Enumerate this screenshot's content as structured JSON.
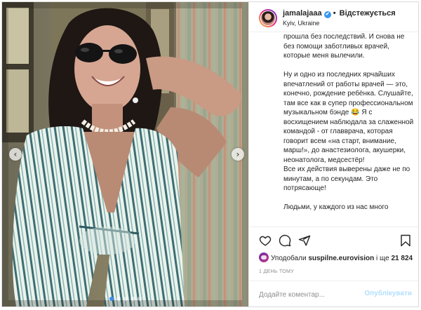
{
  "header": {
    "username": "jamalajaaa",
    "verified_badge": "✔",
    "separator": "•",
    "follow_label": "Відстежується",
    "location": "Kyiv, Ukraine"
  },
  "caption": {
    "text": "Так как слабенькое место у меня самое ценное — горло. Благо, болезнь прошла без последствий. И снова не без помощи заботливых врачей, которые меня вылечили.\n\nНу и одно из последних ярчайших впечатлений от работы врачей — это, конечно, рождение ребёнка. Слушайте, там все как в супер профессиональном музыкальном бэнде 😂 Я с восхищением наблюдала за слаженной командой - от главврача, которая говорит всем «на старт, внимание, марш!», до анастезиолога, акушерки, неонатолога, медсестёр!\nВсе их действия выверены даже не по минутам, а по секундам. Это потрясающе!\n\nЛюдьми, у каждого из нас много"
  },
  "photo": {
    "prev_arrow": "‹",
    "next_arrow": "›",
    "slide_count": 5,
    "active_slide": 1
  },
  "actions": {
    "likes_prefix": "Уподобали",
    "likes_user": "suspilne.eurovision",
    "likes_mid": "і ще",
    "likes_count": "21 824",
    "timestamp": "1 ДЕНЬ ТОМУ"
  },
  "comment_box": {
    "placeholder": "Додайте коментар...",
    "post_label": "Опублікувати"
  },
  "colors": {
    "accent": "#3897f0",
    "post_disabled": "#b2dffc",
    "muted": "#8e8e8e",
    "border": "#dbdbdb"
  }
}
